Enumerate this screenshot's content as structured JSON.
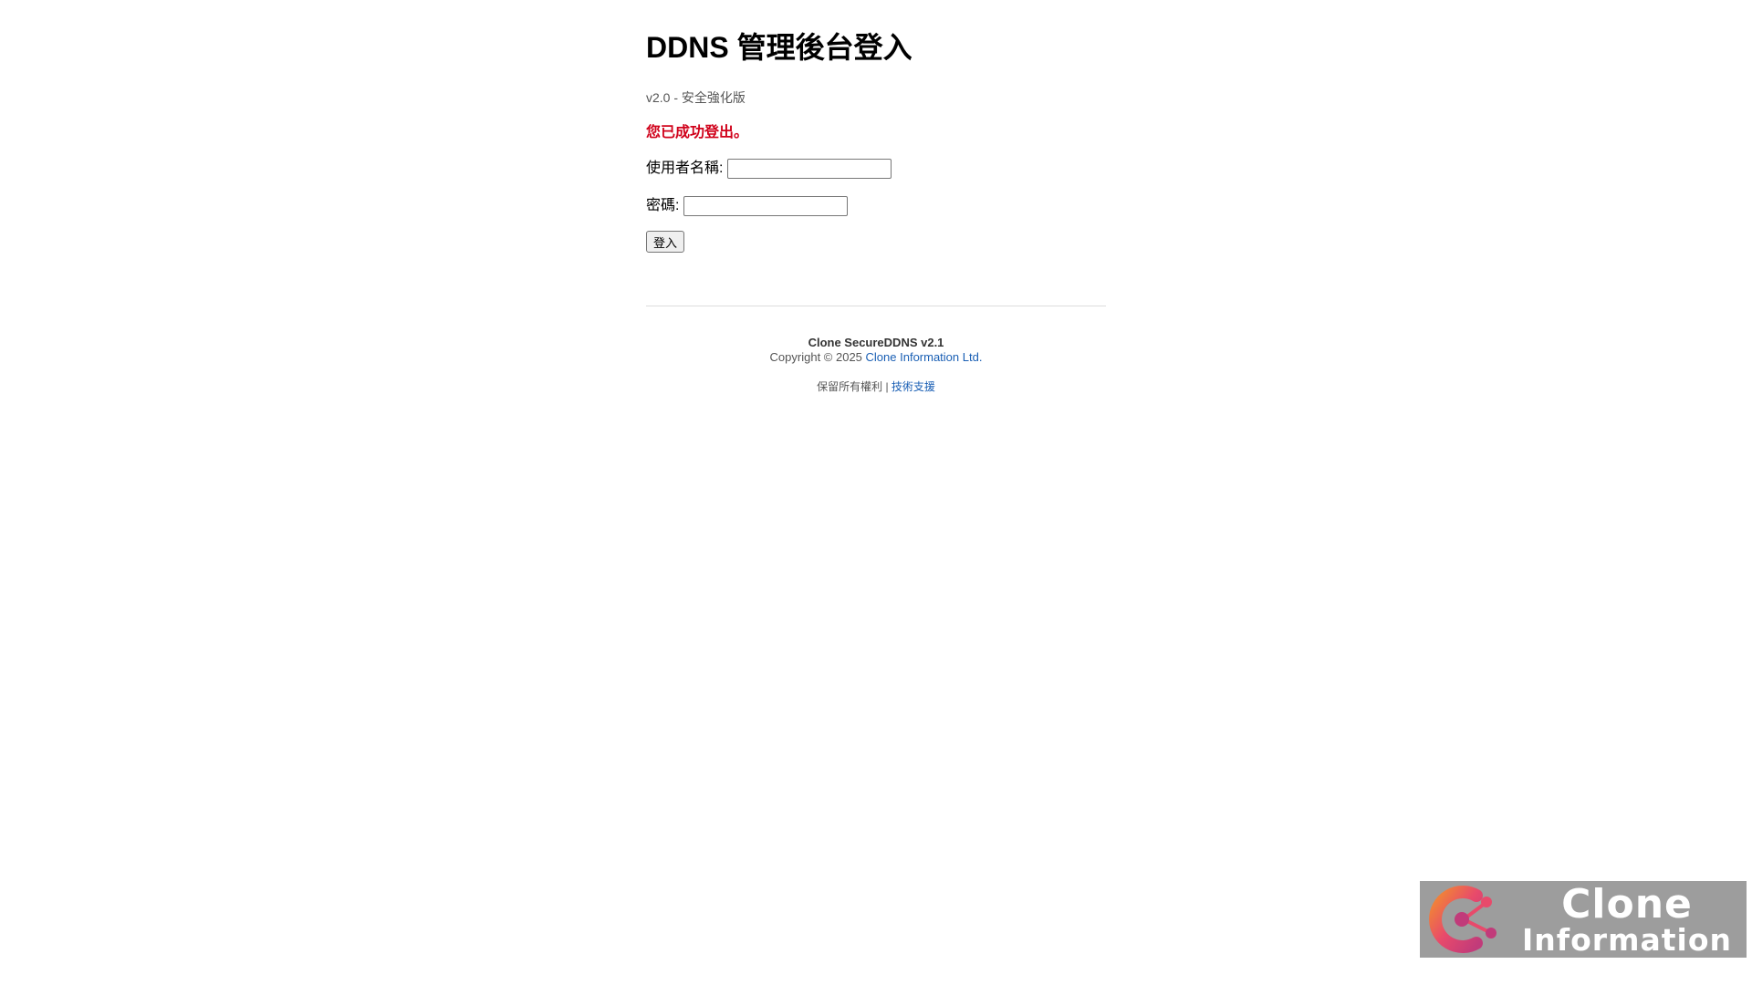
{
  "header": {
    "title": "DDNS 管理後台登入",
    "version": "v2.0 - 安全強化版"
  },
  "status": {
    "message": "您已成功登出。",
    "color": "#d0021b"
  },
  "form": {
    "username_label": "使用者名稱:",
    "username_value": "",
    "password_label": "密碼:",
    "password_value": "",
    "submit_label": "登入"
  },
  "footer": {
    "product": "Clone SecureDDNS v2.1",
    "copyright_prefix": "Copyright © 2025",
    "company_link": "Clone Information Ltd.",
    "rights": "保留所有權利",
    "separator": "|",
    "support_link": "技術支援",
    "link_color": "#1a5fb4"
  },
  "logo": {
    "line1": "Clone",
    "line2": "Information",
    "icon": "clone-logo-mark-icon"
  }
}
